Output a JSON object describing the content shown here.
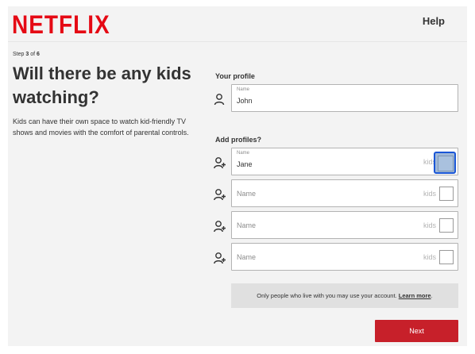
{
  "header": {
    "logo": "NETFLIX",
    "help_label": "Help"
  },
  "intro": {
    "step_prefix": "Step ",
    "step_current": "3",
    "step_of": " of ",
    "step_total": "6",
    "headline": "Will there be any kids watching?",
    "description": "Kids can have their own space to watch kid-friendly TV shows and movies with the comfort of parental controls."
  },
  "your_profile": {
    "label": "Your profile",
    "field_label": "Name",
    "value": "John"
  },
  "add_profiles": {
    "label": "Add profiles?",
    "kids_label": "kids",
    "profiles": [
      {
        "field_label": "Name",
        "value": "Jane",
        "placeholder": ""
      },
      {
        "field_label": "",
        "value": "",
        "placeholder": "Name"
      },
      {
        "field_label": "",
        "value": "",
        "placeholder": "Name"
      },
      {
        "field_label": "",
        "value": "",
        "placeholder": "Name"
      }
    ]
  },
  "notice": {
    "text": "Only people who live with you may use your account. ",
    "link": "Learn more",
    "suffix": "."
  },
  "next_label": "Next",
  "colors": {
    "brand_red": "#e50914",
    "button_red": "#c7202a",
    "focus_blue": "#1a56d6",
    "background": "#f3f3f3"
  },
  "icons": {
    "profile": "person-icon",
    "add_profile": "person-add-icon"
  }
}
